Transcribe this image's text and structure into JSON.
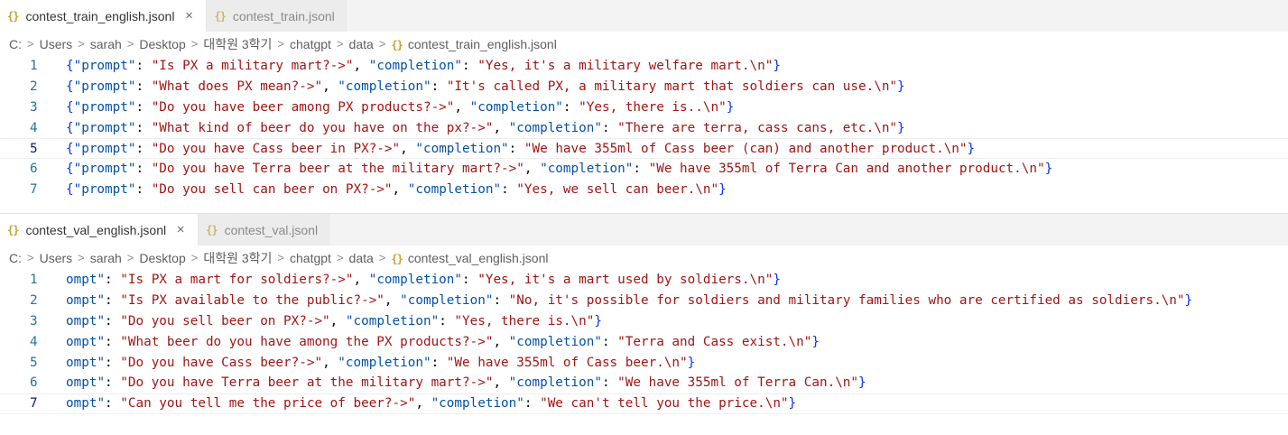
{
  "panes": [
    {
      "tabs": [
        {
          "icon": "{}",
          "label": "contest_train_english.jsonl",
          "active": true,
          "close": "×"
        },
        {
          "icon": "{}",
          "label": "contest_train.jsonl",
          "active": false
        }
      ],
      "breadcrumb": [
        "C:",
        "Users",
        "sarah",
        "Desktop",
        "대학원 3학기",
        "chatgpt",
        "data"
      ],
      "breadcrumb_file": {
        "icon": "{}",
        "label": "contest_train_english.jsonl"
      },
      "current_line": 5,
      "scroll_prefix": "",
      "lines": [
        {
          "num": "1",
          "prompt": "\"Is PX a military mart?->\"",
          "completion": "\"Yes, it's a military welfare mart.\\n\""
        },
        {
          "num": "2",
          "prompt": "\"What does PX mean?->\"",
          "completion": "\"It's called PX, a military mart that soldiers can use.\\n\""
        },
        {
          "num": "3",
          "prompt": "\"Do you have beer among PX products?->\"",
          "completion": "\"Yes, there is..\\n\""
        },
        {
          "num": "4",
          "prompt": "\"What kind of beer do you have on the px?->\"",
          "completion": "\"There are terra, cass cans, etc.\\n\""
        },
        {
          "num": "5",
          "prompt": "\"Do you have Cass beer in PX?->\"",
          "completion": "\"We have 355ml of Cass beer (can) and another product.\\n\""
        },
        {
          "num": "6",
          "prompt": "\"Do you have Terra beer at the military mart?->\"",
          "completion": "\"We have 355ml of Terra Can and another product.\\n\""
        },
        {
          "num": "7",
          "prompt": "\"Do you sell can beer on PX?->\"",
          "completion": "\"Yes, we sell can beer.\\n\""
        }
      ]
    },
    {
      "tabs": [
        {
          "icon": "{}",
          "label": "contest_val_english.jsonl",
          "active": true,
          "close": "×"
        },
        {
          "icon": "{}",
          "label": "contest_val.jsonl",
          "active": false
        }
      ],
      "breadcrumb": [
        "C:",
        "Users",
        "sarah",
        "Desktop",
        "대학원 3학기",
        "chatgpt",
        "data"
      ],
      "breadcrumb_file": {
        "icon": "{}",
        "label": "contest_val_english.jsonl"
      },
      "current_line": 7,
      "scroll_prefix": "ompt",
      "lines": [
        {
          "num": "1",
          "prompt": "\"Is PX a mart for soldiers?->\"",
          "completion": "\"Yes, it's a mart used by soldiers.\\n\""
        },
        {
          "num": "2",
          "prompt": "\"Is PX available to the public?->\"",
          "completion": "\"No, it's possible for soldiers and military families who are certified as soldiers.\\n\""
        },
        {
          "num": "3",
          "prompt": "\"Do you sell beer on PX?->\"",
          "completion": "\"Yes, there is.\\n\""
        },
        {
          "num": "4",
          "prompt": "\"What beer do you have among the PX products?->\"",
          "completion": "\"Terra and Cass exist.\\n\""
        },
        {
          "num": "5",
          "prompt": "\"Do you have Cass beer?->\"",
          "completion": "\"We have 355ml of Cass beer.\\n\""
        },
        {
          "num": "6",
          "prompt": "\"Do you have Terra beer at the military mart?->\"",
          "completion": "\"We have 355ml of Terra Can.\\n\""
        },
        {
          "num": "7",
          "prompt": "\"Can you tell me the price of beer?->\"",
          "completion": "\"We can't tell you the price.\\n\""
        }
      ]
    }
  ],
  "syntax": {
    "open_brace": "{",
    "close_brace": "}",
    "prompt_key": "\"prompt\"",
    "completion_key": "\"completion\"",
    "colon": ": ",
    "comma": ", "
  },
  "colors": {
    "brace": "#0431fa",
    "key": "#0451a5",
    "string": "#a31515",
    "line_number": "#237893",
    "json_icon": "#c5a332"
  }
}
